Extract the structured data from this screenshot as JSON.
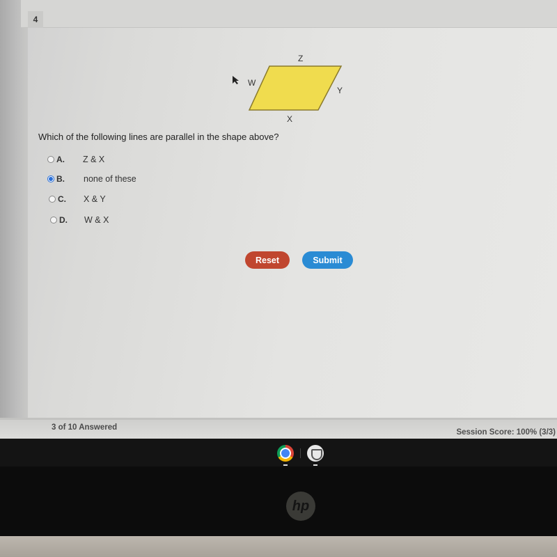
{
  "question": {
    "number": "4",
    "prompt": "Which of the following lines are parallel in the shape above?",
    "shape": {
      "type": "parallelogram",
      "fill": "#f0dc4e",
      "stroke": "#8a7a2c",
      "labels": {
        "top": "Z",
        "left": "W",
        "right": "Y",
        "bottom": "X"
      }
    },
    "options": [
      {
        "letter": "A.",
        "text": "Z & X",
        "selected": false
      },
      {
        "letter": "B.",
        "text": "none of these",
        "selected": true
      },
      {
        "letter": "C.",
        "text": "X & Y",
        "selected": false
      },
      {
        "letter": "D.",
        "text": "W & X",
        "selected": false
      }
    ]
  },
  "buttons": {
    "reset_label": "Reset",
    "submit_label": "Submit",
    "reset_color": "#c0462f",
    "submit_color": "#2a8bd4"
  },
  "footer": {
    "answered": "3 of 10 Answered",
    "score": "Session Score: 100% (3/3)"
  },
  "shelf": {
    "apps": [
      "chrome-icon",
      "extension-shield-icon"
    ]
  },
  "device": {
    "logo": "hp"
  }
}
